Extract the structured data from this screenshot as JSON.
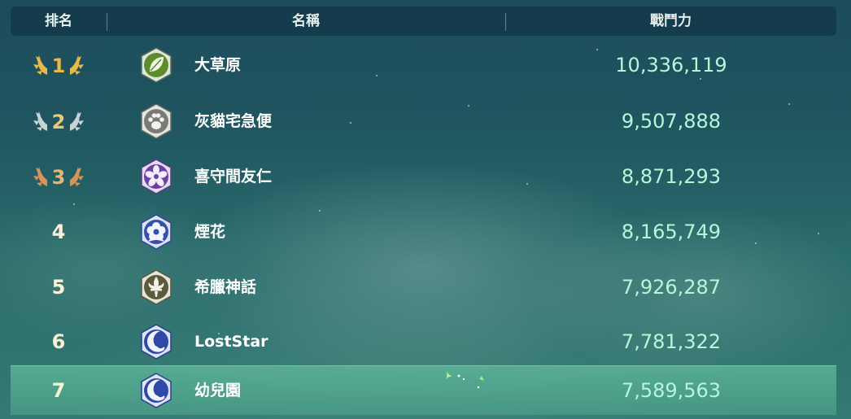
{
  "header": {
    "rank": "排名",
    "name": "名稱",
    "power": "戰鬥力"
  },
  "rows": [
    {
      "rank": "1",
      "name": "大草原",
      "power": "10,336,119",
      "emblem": "leaf-icon",
      "medal": "gold"
    },
    {
      "rank": "2",
      "name": "灰貓宅急便",
      "power": "9,507,888",
      "emblem": "paw-icon",
      "medal": "silver"
    },
    {
      "rank": "3",
      "name": "喜守間友仁",
      "power": "8,871,293",
      "emblem": "flower-icon",
      "medal": "bronze"
    },
    {
      "rank": "4",
      "name": "煙花",
      "power": "8,165,749",
      "emblem": "blossom-icon"
    },
    {
      "rank": "5",
      "name": "希臘神話",
      "power": "7,926,287",
      "emblem": "fleur-de-lis-icon"
    },
    {
      "rank": "6",
      "name": "LostStar",
      "power": "7,781,322",
      "emblem": "crescent-wave-icon"
    },
    {
      "rank": "7",
      "name": "幼兒園",
      "power": "7,589,563",
      "emblem": "crescent-wave-icon",
      "highlighted": true
    }
  ],
  "colors": {
    "gold": "#e8b948",
    "silver": "#c9d3d6",
    "bronze": "#d9935a",
    "power_text": "#b8f6d9",
    "highlight_row": "#5cb99a"
  }
}
